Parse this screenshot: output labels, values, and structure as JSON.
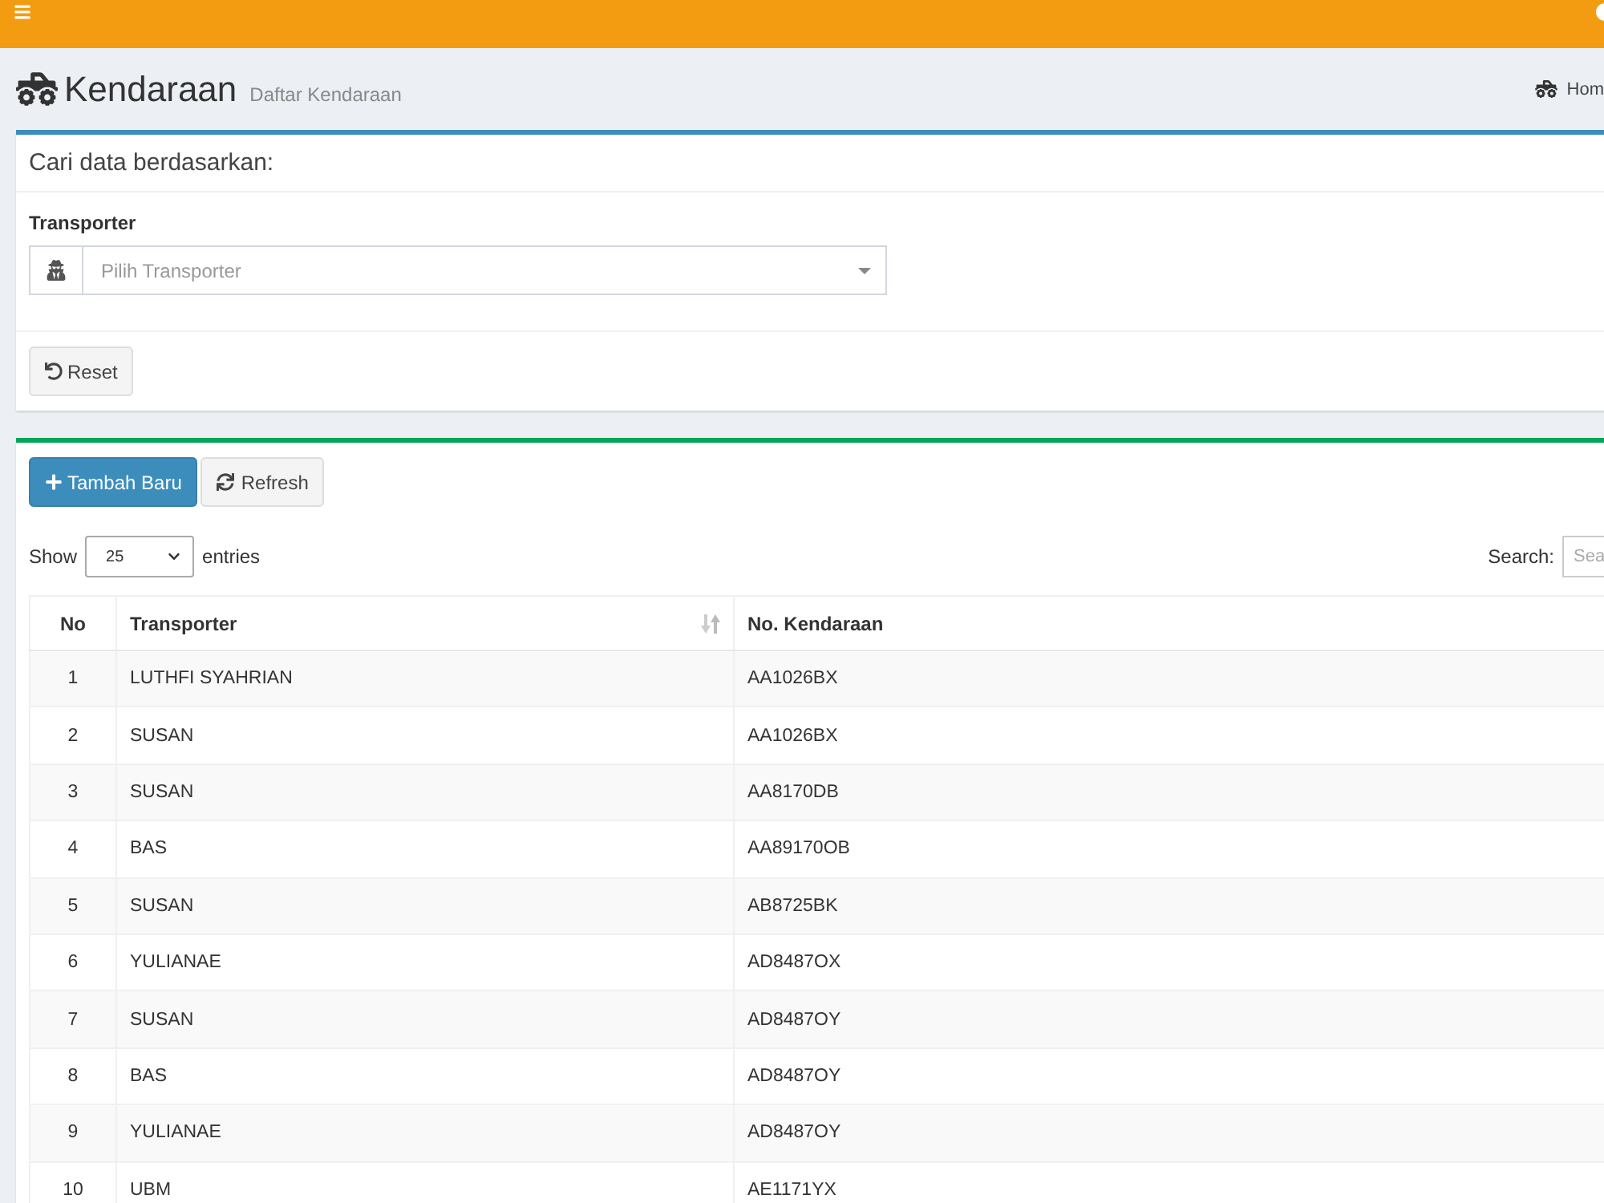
{
  "page_header": {
    "title": "Kendaraan",
    "subtitle": "Daftar Kendaraan",
    "breadcrumb": [
      {
        "label": "Hom"
      }
    ]
  },
  "filter_box": {
    "title": "Cari data berdasarkan:",
    "fields": [
      {
        "label": "Transporter",
        "placeholder": "Pilih Transporter"
      }
    ],
    "buttons": [
      {
        "kind": "reset",
        "label": "Reset"
      }
    ]
  },
  "data_box": {
    "buttons": [
      {
        "kind": "add",
        "label": "Tambah Baru"
      },
      {
        "kind": "refresh",
        "label": "Refresh"
      }
    ],
    "length_menu": {
      "prefix": "Show",
      "value": "25",
      "suffix": "entries"
    },
    "search": {
      "label": "Search:",
      "placeholder": "Sea"
    },
    "table": {
      "columns": [
        {
          "label": "No",
          "sortable": false
        },
        {
          "label": "Transporter",
          "sortable": true
        },
        {
          "label": "No. Kendaraan",
          "sortable": false
        }
      ],
      "rows": [
        [
          "1",
          "LUTHFI SYAHRIAN",
          "AA1026BX"
        ],
        [
          "2",
          "SUSAN",
          "AA1026BX"
        ],
        [
          "3",
          "SUSAN",
          "AA8170DB"
        ],
        [
          "4",
          "BAS",
          "AA89170OB"
        ],
        [
          "5",
          "SUSAN",
          "AB8725BK"
        ],
        [
          "6",
          "YULIANAE",
          "AD8487OX"
        ],
        [
          "7",
          "SUSAN",
          "AD8487OY"
        ],
        [
          "8",
          "BAS",
          "AD8487OY"
        ],
        [
          "9",
          "YULIANAE",
          "AD8487OY"
        ],
        [
          "10",
          "UBM",
          "AE1171YX"
        ]
      ]
    }
  }
}
